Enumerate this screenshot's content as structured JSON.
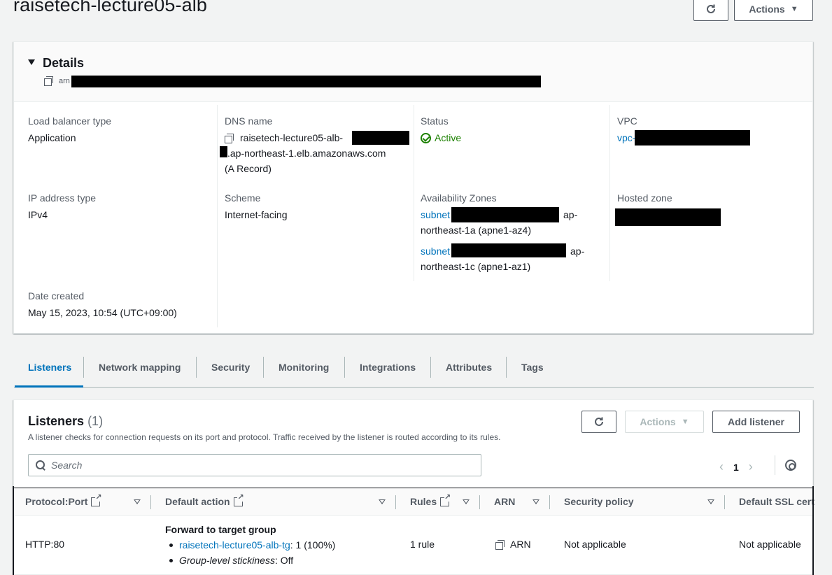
{
  "page": {
    "title": "raisetech-lecture05-alb",
    "actions_label": "Actions"
  },
  "details": {
    "heading": "Details",
    "arn_prefix": "arn",
    "load_balancer_type": {
      "label": "Load balancer type",
      "value": "Application"
    },
    "dns_name": {
      "label": "DNS name",
      "line1": "raisetech-lecture05-alb-",
      "line2": ".ap-northeast-1.elb.amazonaws.com",
      "line3": "(A Record)"
    },
    "status": {
      "label": "Status",
      "value": "Active"
    },
    "vpc": {
      "label": "VPC",
      "value": "vpc-"
    },
    "ip_address_type": {
      "label": "IP address type",
      "value": "IPv4"
    },
    "scheme": {
      "label": "Scheme",
      "value": "Internet-facing"
    },
    "availability_zones": {
      "label": "Availability Zones",
      "items": [
        {
          "subnet": "subnet",
          "zone_a": "ap-",
          "zone_b": "northeast-1a (apne1-az4)"
        },
        {
          "subnet": "subnet",
          "zone_a": "ap-",
          "zone_b": "northeast-1c (apne1-az1)"
        }
      ]
    },
    "hosted_zone": {
      "label": "Hosted zone"
    },
    "date_created": {
      "label": "Date created",
      "value": "May 15, 2023, 10:54 (UTC+09:00)"
    }
  },
  "tabs": [
    "Listeners",
    "Network mapping",
    "Security",
    "Monitoring",
    "Integrations",
    "Attributes",
    "Tags"
  ],
  "listeners": {
    "title": "Listeners",
    "count": "(1)",
    "description": "A listener checks for connection requests on its port and protocol. Traffic received by the listener is routed according to its rules.",
    "actions_label": "Actions",
    "add_label": "Add listener",
    "search_placeholder": "Search",
    "page_number": "1",
    "columns": [
      "Protocol:Port",
      "Default action",
      "Rules",
      "ARN",
      "Security policy",
      "Default SSL cert"
    ],
    "row": {
      "protocol_port": "HTTP:80",
      "action_title": "Forward to target group",
      "target_group": "raisetech-lecture05-alb-tg",
      "target_weight": ": 1 (100%)",
      "stickiness_label": "Group-level stickiness",
      "stickiness_value": ": Off",
      "rules": "1 rule",
      "arn": "ARN",
      "security_policy": "Not applicable",
      "ssl_cert": "Not applicable"
    }
  },
  "colors": {
    "link": "#0073bb",
    "success": "#1d8102",
    "text": "#16191f",
    "muted": "#545b64"
  }
}
